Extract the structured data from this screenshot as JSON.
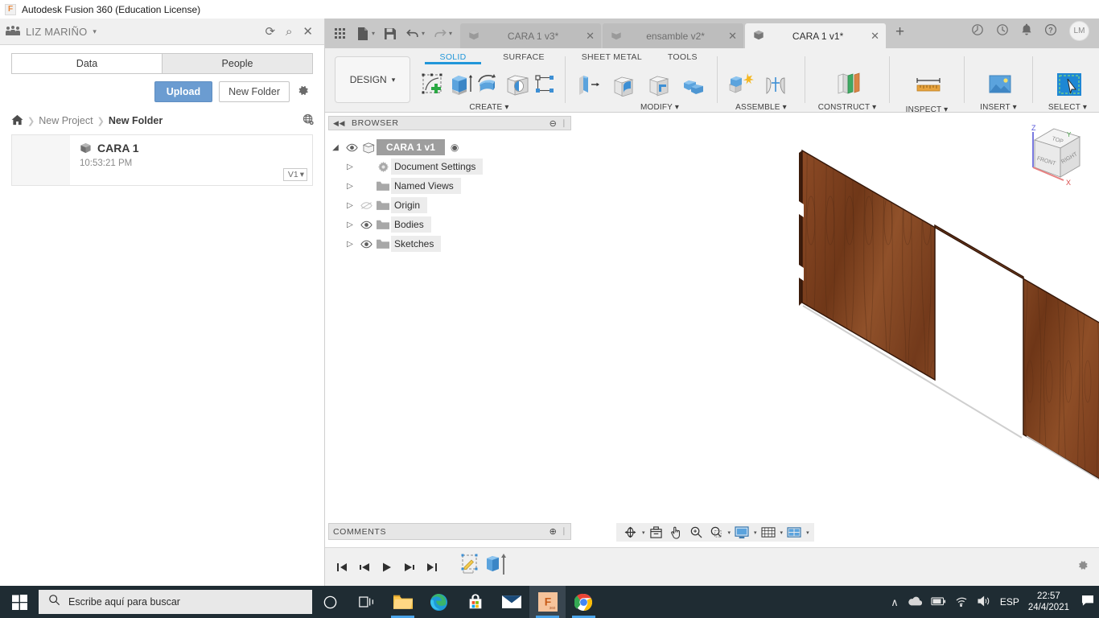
{
  "window": {
    "title": "Autodesk Fusion 360 (Education License)",
    "logo_letter": "F",
    "minimize_label": "—",
    "maximize_label": "❐",
    "close_label": "✕"
  },
  "data_panel": {
    "user_name": "LIZ MARIÑO",
    "user_caret": "▾",
    "header_icons": [
      {
        "name": "refresh-icon",
        "glyph": "⟳"
      },
      {
        "name": "search-icon",
        "glyph": "⌕"
      },
      {
        "name": "close-panel-icon",
        "glyph": "✕"
      }
    ],
    "tabs": [
      {
        "label": "Data",
        "active": true
      },
      {
        "label": "People",
        "active": false
      }
    ],
    "upload_label": "Upload",
    "new_folder_label": "New Folder",
    "settings_icon": "⚙",
    "breadcrumb": {
      "home_icon": "⌂",
      "separator": "❯",
      "items": [
        {
          "label": "New Project",
          "current": false
        },
        {
          "label": "New Folder",
          "current": true
        }
      ],
      "globe_icon": "♁"
    },
    "files": [
      {
        "name": "CARA 1",
        "time": "10:53:21 PM",
        "version": "V1",
        "version_caret": "▾"
      }
    ]
  },
  "quick_access": {
    "grid_icon": "☰",
    "new_icon": "file-new",
    "save_icon": "save",
    "undo_icon": "undo",
    "redo_icon": "redo",
    "caret": "▾"
  },
  "document_tabs": [
    {
      "label": "CARA 1 v3*",
      "active": false,
      "close": "✕"
    },
    {
      "label": "ensamble v2*",
      "active": false,
      "close": "✕"
    },
    {
      "label": "CARA 1 v1*",
      "active": true,
      "close": "✕"
    }
  ],
  "tab_add_label": "+",
  "tabstrip_right_icons": [
    {
      "name": "job-status-icon",
      "glyph": "◔"
    },
    {
      "name": "recent-icon",
      "glyph": "◴"
    },
    {
      "name": "notification-bell-icon",
      "glyph": "♪"
    },
    {
      "name": "help-icon",
      "glyph": "?"
    }
  ],
  "avatar_initials": "LM",
  "ribbon": {
    "design_label": "DESIGN",
    "design_caret": "▾",
    "tabs": [
      {
        "label": "SOLID",
        "active": true
      },
      {
        "label": "SURFACE",
        "active": false
      },
      {
        "label": "SHEET METAL",
        "active": false
      },
      {
        "label": "TOOLS",
        "active": false
      }
    ],
    "groups": [
      {
        "label": "CREATE",
        "caret": "▾"
      },
      {
        "label": "MODIFY",
        "caret": "▾"
      },
      {
        "label": "ASSEMBLE",
        "caret": "▾"
      },
      {
        "label": "CONSTRUCT",
        "caret": "▾"
      },
      {
        "label": "INSPECT",
        "caret": "▾"
      },
      {
        "label": "INSERT",
        "caret": "▾"
      },
      {
        "label": "SELECT",
        "caret": "▾"
      }
    ]
  },
  "browser": {
    "title": "BROWSER",
    "collapse_icon": "◀◀",
    "minimize_icon": "⊖",
    "grip_icon": "∣",
    "root": {
      "label": "CARA 1 v1",
      "expander": "◢",
      "eye": "visible",
      "radio": "◉"
    },
    "items": [
      {
        "label": "Document Settings",
        "icon": "gear",
        "eye": "none",
        "expander": "▷"
      },
      {
        "label": "Named Views",
        "icon": "folder",
        "eye": "none",
        "expander": "▷"
      },
      {
        "label": "Origin",
        "icon": "folder",
        "eye": "hidden",
        "expander": "▷"
      },
      {
        "label": "Bodies",
        "icon": "folder",
        "eye": "visible",
        "expander": "▷"
      },
      {
        "label": "Sketches",
        "icon": "folder",
        "eye": "visible",
        "expander": "▷"
      }
    ]
  },
  "comments": {
    "title": "COMMENTS",
    "add_icon": "⊕",
    "grip_icon": "∣"
  },
  "navbar": [
    {
      "name": "orbit-icon",
      "caret": "▾"
    },
    {
      "name": "look-at-icon",
      "caret": ""
    },
    {
      "name": "pan-icon",
      "caret": ""
    },
    {
      "name": "zoom-icon",
      "caret": ""
    },
    {
      "name": "zoom-window-icon",
      "caret": "▾"
    },
    {
      "name": "display-settings-icon",
      "caret": "▾"
    },
    {
      "name": "grid-snaps-icon",
      "caret": "▾"
    },
    {
      "name": "viewports-icon",
      "caret": "▾"
    }
  ],
  "timeline": {
    "buttons": [
      {
        "name": "go-to-beginning-icon",
        "glyph": "first"
      },
      {
        "name": "step-back-icon",
        "glyph": "prev"
      },
      {
        "name": "play-icon",
        "glyph": "play"
      },
      {
        "name": "step-forward-icon",
        "glyph": "next"
      },
      {
        "name": "go-to-end-icon",
        "glyph": "last"
      }
    ],
    "features": [
      {
        "name": "sketch-feature",
        "label": ""
      },
      {
        "name": "extrude-feature",
        "label": ""
      }
    ],
    "settings_icon": "⚙"
  },
  "viewcube": {
    "top_label": "TOP",
    "front_label": "FRONT",
    "right_label": "RIGHT",
    "axis_x": "X",
    "axis_y": "Y",
    "axis_z": "Z"
  },
  "model": {
    "material": "wood",
    "base_color": "#8a4a25",
    "dark_color": "#5d2d14",
    "edge_color": "#3a1c0b"
  },
  "taskbar": {
    "start_label": "Start",
    "search_placeholder": "Escribe aquí para buscar",
    "search_icon": "⌕",
    "items": [
      {
        "name": "cortana-icon",
        "active": false,
        "running": false
      },
      {
        "name": "task-view-icon",
        "active": false,
        "running": false
      },
      {
        "name": "file-explorer-icon",
        "active": false,
        "running": true
      },
      {
        "name": "microsoft-edge-icon",
        "active": false,
        "running": false
      },
      {
        "name": "microsoft-store-icon",
        "active": false,
        "running": false
      },
      {
        "name": "mail-icon",
        "active": false,
        "running": false
      },
      {
        "name": "fusion-360-icon",
        "active": true,
        "running": true
      },
      {
        "name": "google-chrome-icon",
        "active": false,
        "running": true
      }
    ],
    "tray": {
      "chevron": "∧",
      "onedrive": "cloud",
      "battery": "battery",
      "wifi": "wifi",
      "volume": "volume",
      "language": "ESP",
      "time": "22:57",
      "date": "24/4/2021",
      "notifications": "notifications"
    }
  }
}
